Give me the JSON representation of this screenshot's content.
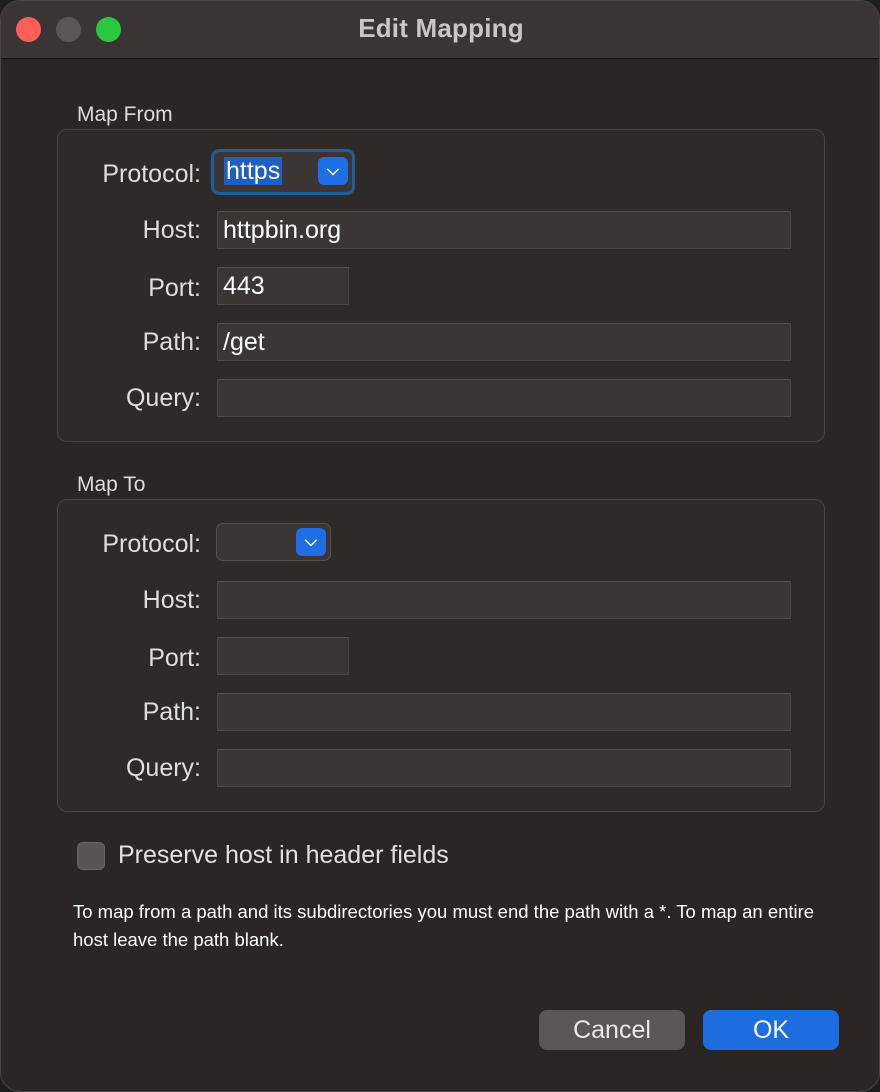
{
  "window": {
    "title": "Edit Mapping"
  },
  "map_from": {
    "title": "Map From",
    "protocol_label": "Protocol:",
    "protocol_value": "https",
    "host_label": "Host:",
    "host_value": "httpbin.org",
    "port_label": "Port:",
    "port_value": "443",
    "path_label": "Path:",
    "path_value": "/get",
    "query_label": "Query:",
    "query_value": ""
  },
  "map_to": {
    "title": "Map To",
    "protocol_label": "Protocol:",
    "protocol_value": "",
    "host_label": "Host:",
    "host_value": "",
    "port_label": "Port:",
    "port_value": "",
    "path_label": "Path:",
    "path_value": "",
    "query_label": "Query:",
    "query_value": ""
  },
  "preserve_host": {
    "label": "Preserve host in header fields",
    "checked": false
  },
  "note": "To map from a path and its subdirectories you must end the path with a *. To map an entire host leave the path blank.",
  "buttons": {
    "cancel": "Cancel",
    "ok": "OK"
  },
  "icons": {
    "popup": "chevron-down-icon"
  },
  "colors": {
    "accent": "#1b6de0",
    "close": "#fe5f57",
    "maximize": "#28c840"
  }
}
